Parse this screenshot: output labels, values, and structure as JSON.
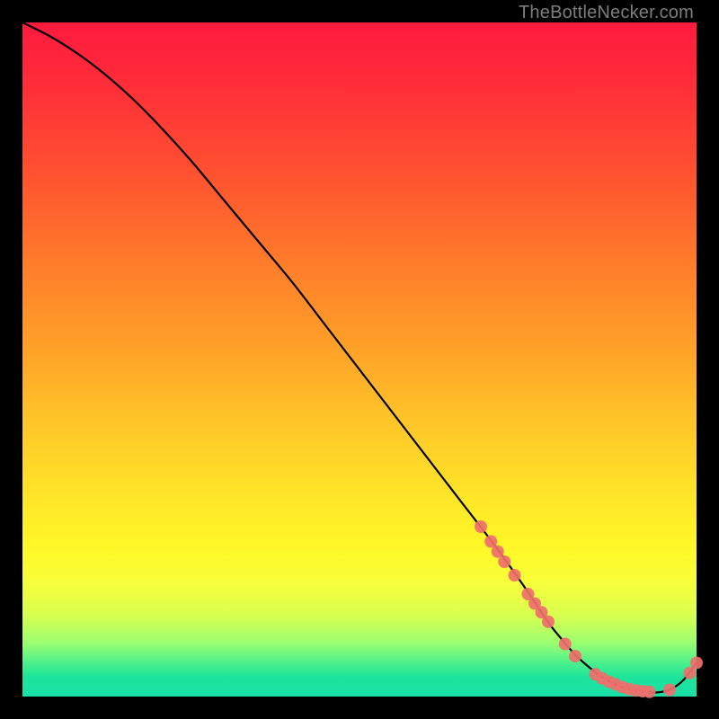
{
  "watermark": "TheBottleNecker.com",
  "chart_data": {
    "type": "line",
    "title": "",
    "xlabel": "",
    "ylabel": "",
    "xlim": [
      0,
      100
    ],
    "ylim": [
      0,
      100
    ],
    "series": [
      {
        "name": "curve",
        "x": [
          0,
          4,
          8,
          12,
          16,
          20,
          25,
          30,
          35,
          40,
          45,
          50,
          55,
          60,
          65,
          70,
          75,
          78,
          80,
          82,
          84,
          86,
          88,
          90,
          92,
          94,
          96,
          98,
          100
        ],
        "y": [
          100,
          98,
          95.5,
          92.5,
          89,
          85,
          79.5,
          73.5,
          67.5,
          61.5,
          55,
          48.5,
          42,
          35.5,
          29,
          22.5,
          15.5,
          11,
          8.5,
          6.2,
          4.4,
          2.9,
          1.8,
          1.1,
          0.7,
          0.6,
          1.0,
          2.4,
          5.0
        ]
      }
    ],
    "markers": [
      {
        "x": 68.0,
        "y": 25.2
      },
      {
        "x": 69.5,
        "y": 23.0
      },
      {
        "x": 70.5,
        "y": 21.5
      },
      {
        "x": 71.5,
        "y": 20.0
      },
      {
        "x": 73.0,
        "y": 18.0
      },
      {
        "x": 75.0,
        "y": 15.2
      },
      {
        "x": 76.0,
        "y": 13.8
      },
      {
        "x": 77.0,
        "y": 12.5
      },
      {
        "x": 78.0,
        "y": 11.1
      },
      {
        "x": 80.5,
        "y": 7.8
      },
      {
        "x": 82.0,
        "y": 6.0
      },
      {
        "x": 85.0,
        "y": 3.3
      },
      {
        "x": 86.0,
        "y": 2.7
      },
      {
        "x": 87.0,
        "y": 2.2
      },
      {
        "x": 88.0,
        "y": 1.8
      },
      {
        "x": 89.0,
        "y": 1.4
      },
      {
        "x": 90.0,
        "y": 1.1
      },
      {
        "x": 91.0,
        "y": 0.9
      },
      {
        "x": 92.0,
        "y": 0.8
      },
      {
        "x": 93.0,
        "y": 0.7
      },
      {
        "x": 96.0,
        "y": 1.0
      },
      {
        "x": 99.0,
        "y": 3.5
      },
      {
        "x": 100.0,
        "y": 5.0
      }
    ],
    "marker_color": "#ef6f6b",
    "curve_color": "#000000",
    "curve_width": 2.2,
    "marker_radius": 7
  }
}
